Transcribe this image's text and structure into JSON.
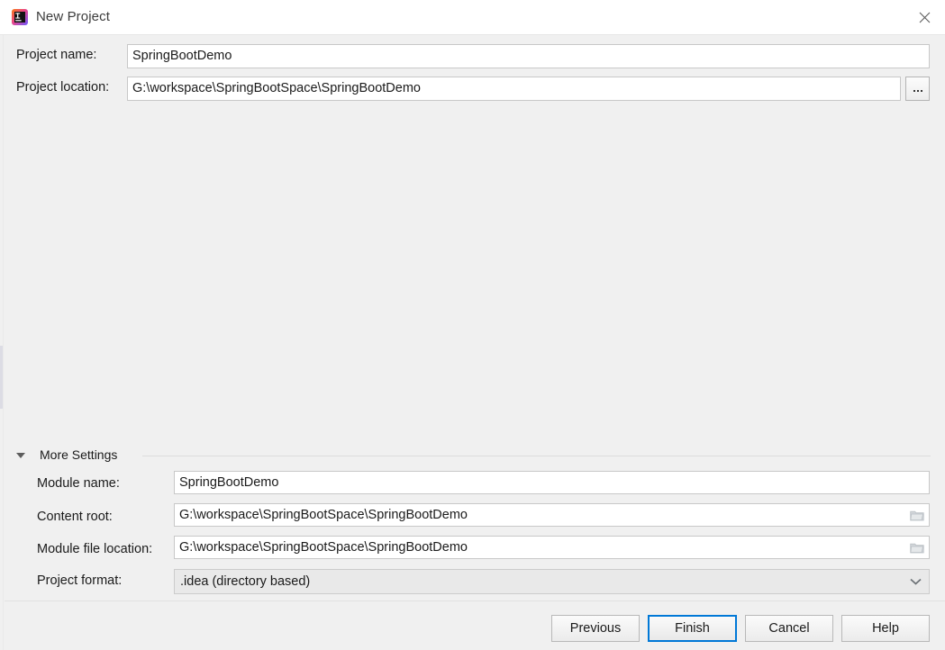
{
  "window": {
    "title": "New Project",
    "app_icon": "intellij-idea-icon",
    "close_icon": "close-icon",
    "accent_color": "#0078d7",
    "titlebar_background": "#ffffff",
    "body_background": "#f0f0f0"
  },
  "form": {
    "project_name": {
      "label": "Project name:",
      "value": "SpringBootDemo",
      "placeholder": ""
    },
    "project_location": {
      "label": "Project location:",
      "value": "G:\\workspace\\SpringBootSpace\\SpringBootDemo",
      "placeholder": "",
      "browse_button_label": "...",
      "browse_icon": "ellipsis-icon"
    }
  },
  "more_settings": {
    "label": "More Settings",
    "expanded": true,
    "toggle_icon": "chevron-down-icon",
    "module_name": {
      "label": "Module name:",
      "value": "SpringBootDemo",
      "placeholder": ""
    },
    "content_root": {
      "label": "Content root:",
      "value": "G:\\workspace\\SpringBootSpace\\SpringBootDemo",
      "placeholder": "",
      "browse_icon": "folder-icon"
    },
    "module_file_location": {
      "label": "Module file location:",
      "value": "G:\\workspace\\SpringBootSpace\\SpringBootDemo",
      "placeholder": "",
      "browse_icon": "folder-icon"
    },
    "project_format": {
      "label": "Project format:",
      "selected": ".idea (directory based)",
      "dropdown_icon": "chevron-down-icon"
    }
  },
  "buttons": {
    "previous": "Previous",
    "finish": "Finish",
    "cancel": "Cancel",
    "help": "Help",
    "default_focused": "Finish"
  }
}
